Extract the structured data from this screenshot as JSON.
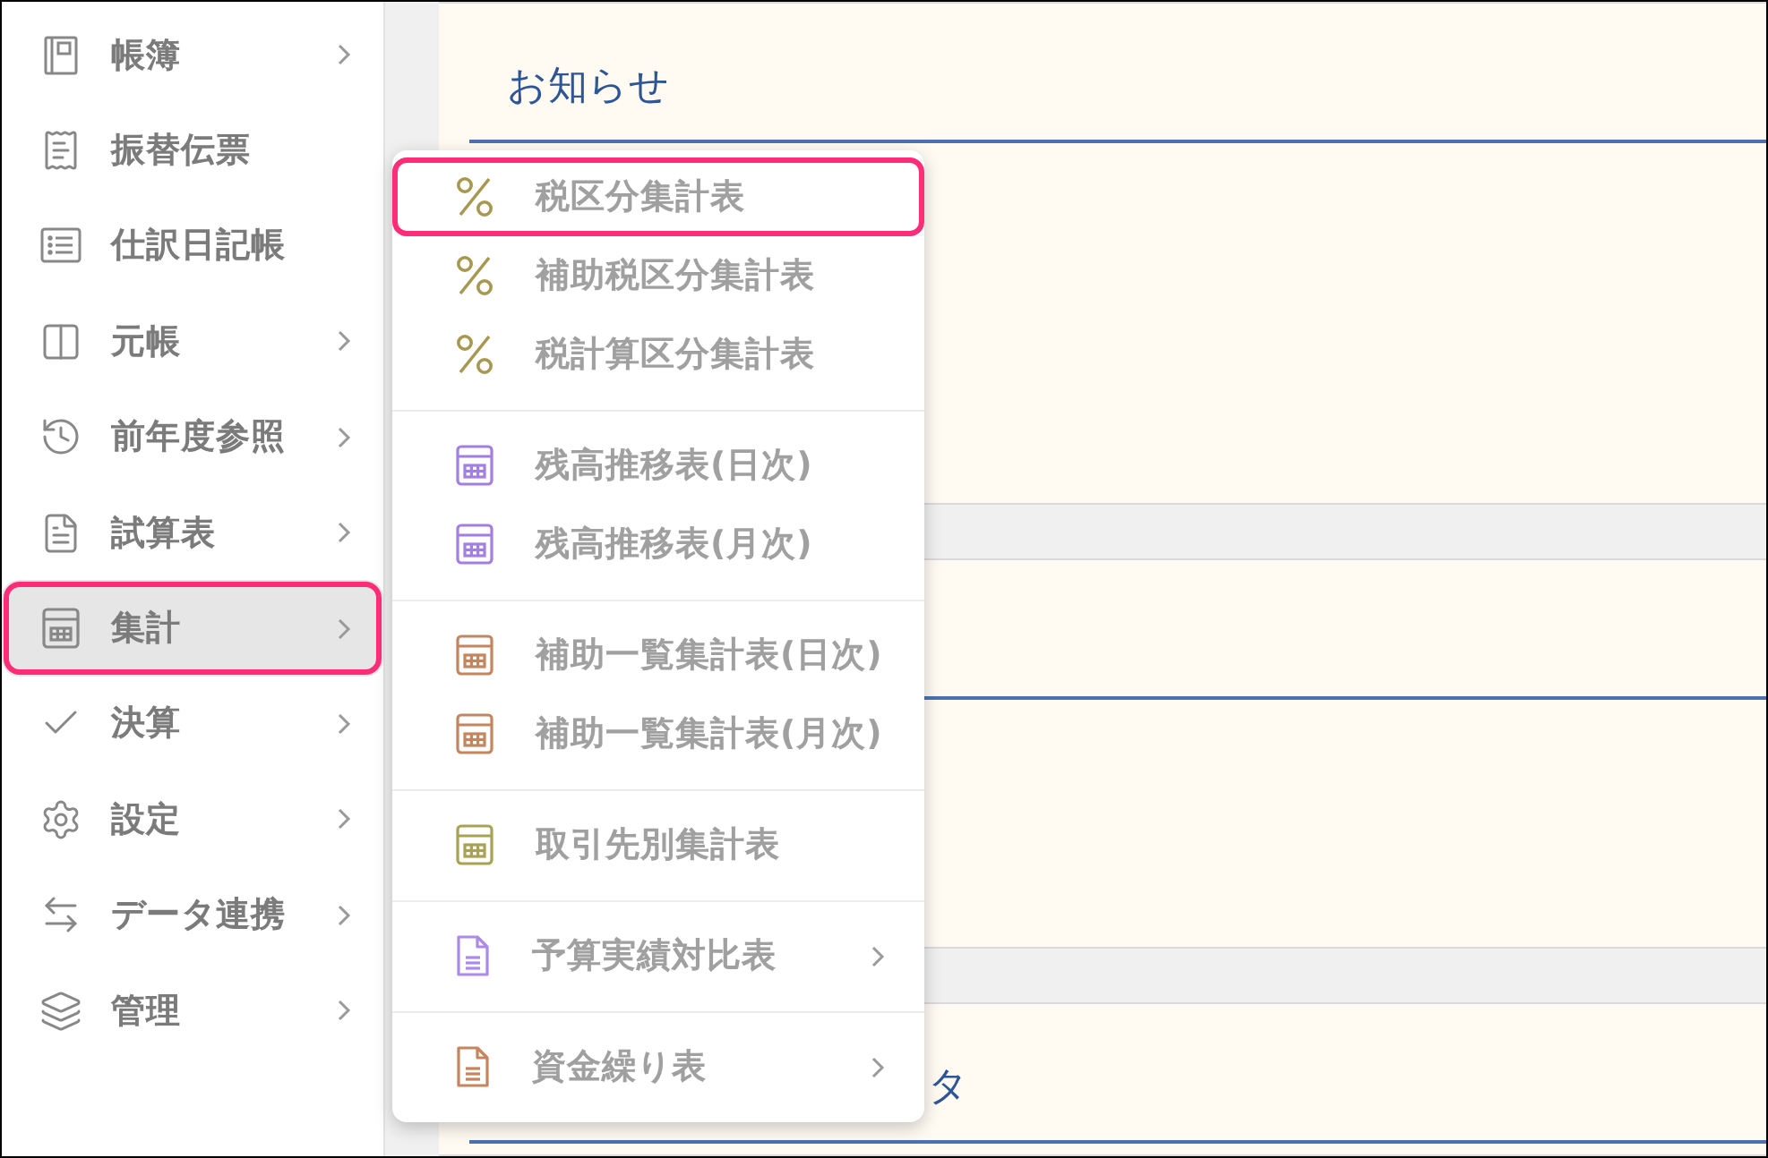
{
  "sidebar": {
    "items": [
      {
        "label": "帳簿",
        "submenu": true,
        "selected": false,
        "highlighted": false
      },
      {
        "label": "振替伝票",
        "submenu": false,
        "selected": false,
        "highlighted": false
      },
      {
        "label": "仕訳日記帳",
        "submenu": false,
        "selected": false,
        "highlighted": false
      },
      {
        "label": "元帳",
        "submenu": true,
        "selected": false,
        "highlighted": false
      },
      {
        "label": "前年度参照",
        "submenu": true,
        "selected": false,
        "highlighted": false
      },
      {
        "label": "試算表",
        "submenu": true,
        "selected": false,
        "highlighted": false
      },
      {
        "label": "集計",
        "submenu": true,
        "selected": true,
        "highlighted": true
      },
      {
        "label": "決算",
        "submenu": true,
        "selected": false,
        "highlighted": false
      },
      {
        "label": "設定",
        "submenu": true,
        "selected": false,
        "highlighted": false
      },
      {
        "label": "データ連携",
        "submenu": true,
        "selected": false,
        "highlighted": false
      },
      {
        "label": "管理",
        "submenu": true,
        "selected": false,
        "highlighted": false
      }
    ]
  },
  "flyout_menu": {
    "groups": [
      {
        "items": [
          {
            "label": "税区分集計表",
            "kind": "percent",
            "color": "#a6994f",
            "submenu": false,
            "highlighted": true
          },
          {
            "label": "補助税区分集計表",
            "kind": "percent",
            "color": "#a6994f",
            "submenu": false,
            "highlighted": false
          },
          {
            "label": "税計算区分集計表",
            "kind": "percent",
            "color": "#a6994f",
            "submenu": false,
            "highlighted": false
          }
        ]
      },
      {
        "items": [
          {
            "label": "残高推移表(日次)",
            "kind": "table",
            "color": "#a47fe3",
            "submenu": false,
            "highlighted": false
          },
          {
            "label": "残高推移表(月次)",
            "kind": "table",
            "color": "#a47fe3",
            "submenu": false,
            "highlighted": false
          }
        ]
      },
      {
        "items": [
          {
            "label": "補助一覧集計表(日次)",
            "kind": "table",
            "color": "#c4855f",
            "submenu": false,
            "highlighted": false
          },
          {
            "label": "補助一覧集計表(月次)",
            "kind": "table",
            "color": "#c4855f",
            "submenu": false,
            "highlighted": false
          }
        ]
      },
      {
        "items": [
          {
            "label": "取引先別集計表",
            "kind": "table",
            "color": "#a9a153",
            "submenu": false,
            "highlighted": false
          }
        ]
      },
      {
        "items": [
          {
            "label": "予算実績対比表",
            "kind": "document",
            "color": "#ab8ae8",
            "submenu": true,
            "highlighted": false
          }
        ]
      },
      {
        "items": [
          {
            "label": "資金繰り表",
            "kind": "document",
            "color": "#c6845f",
            "submenu": true,
            "highlighted": false
          }
        ]
      }
    ]
  },
  "notice_panel": {
    "title": "お知らせ"
  },
  "bottom_panel": {
    "title": "タ"
  }
}
